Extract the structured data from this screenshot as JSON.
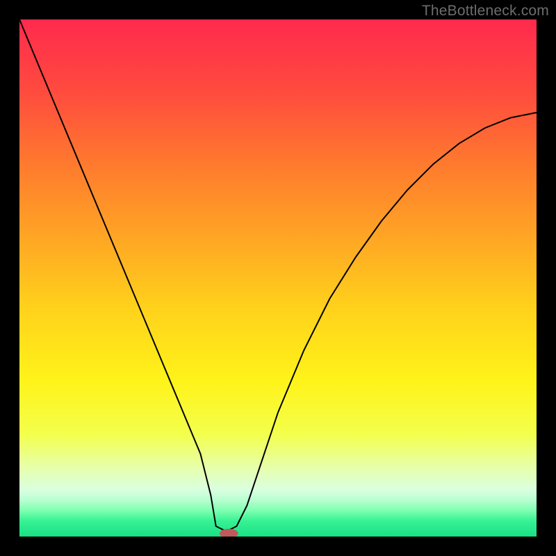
{
  "watermark": "TheBottleneck.com",
  "chart_data": {
    "type": "line",
    "title": "",
    "xlabel": "",
    "ylabel": "",
    "xlim": [
      0,
      100
    ],
    "ylim": [
      0,
      100
    ],
    "grid": false,
    "background": "vertical-gradient",
    "series": [
      {
        "name": "bottleneck-curve",
        "x": [
          0,
          5,
          10,
          15,
          20,
          25,
          30,
          35,
          37,
          38,
          40,
          42,
          44,
          46,
          48,
          50,
          55,
          60,
          65,
          70,
          75,
          80,
          85,
          90,
          95,
          100
        ],
        "values": [
          100,
          88,
          76,
          64,
          52,
          40,
          28,
          16,
          8,
          2,
          1,
          2,
          6,
          12,
          18,
          24,
          36,
          46,
          54,
          61,
          67,
          72,
          76,
          79,
          81,
          82
        ]
      }
    ],
    "marker": {
      "x": 40.5,
      "y": 0.6,
      "color": "#c05a5a",
      "rx": 1.8,
      "ry": 0.9
    },
    "gradient_stops": [
      {
        "offset": 0,
        "color": "#ff2a4d"
      },
      {
        "offset": 14,
        "color": "#ff4b3e"
      },
      {
        "offset": 28,
        "color": "#ff7a2e"
      },
      {
        "offset": 42,
        "color": "#ffa524"
      },
      {
        "offset": 56,
        "color": "#ffd21b"
      },
      {
        "offset": 70,
        "color": "#fff31a"
      },
      {
        "offset": 80,
        "color": "#f3ff4a"
      },
      {
        "offset": 87,
        "color": "#e6ffb0"
      },
      {
        "offset": 91,
        "color": "#d9ffe0"
      },
      {
        "offset": 93,
        "color": "#b6ffd0"
      },
      {
        "offset": 95,
        "color": "#7dffb0"
      },
      {
        "offset": 97,
        "color": "#36f294"
      },
      {
        "offset": 100,
        "color": "#19e085"
      }
    ]
  }
}
